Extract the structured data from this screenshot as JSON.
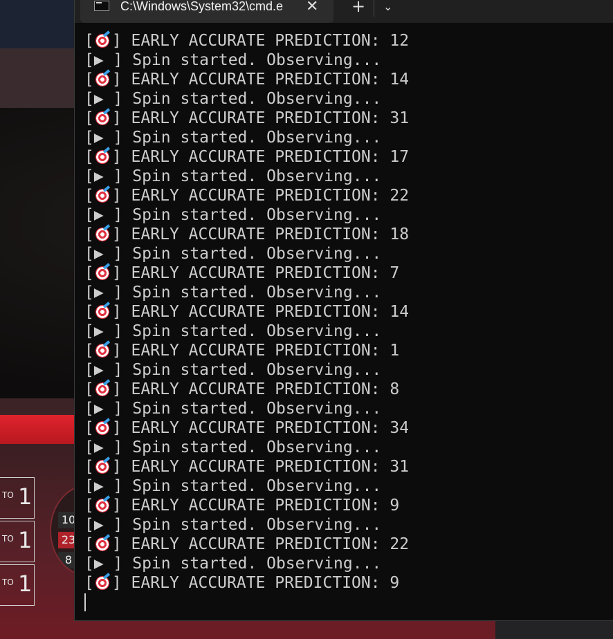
{
  "window": {
    "tab_title": "C:\\Windows\\System32\\cmd.e",
    "close_glyph": "✕",
    "new_tab_glyph": "+",
    "dropdown_glyph": "⌄"
  },
  "console": {
    "lines": [
      {
        "kind": "prediction",
        "text": "] EARLY ACCURATE PREDICTION: 12"
      },
      {
        "kind": "spin",
        "text": "[▶ ] Spin started. Observing..."
      },
      {
        "kind": "prediction",
        "text": "] EARLY ACCURATE PREDICTION: 14"
      },
      {
        "kind": "spin",
        "text": "[▶ ] Spin started. Observing..."
      },
      {
        "kind": "prediction",
        "text": "] EARLY ACCURATE PREDICTION: 31"
      },
      {
        "kind": "spin",
        "text": "[▶ ] Spin started. Observing..."
      },
      {
        "kind": "prediction",
        "text": "] EARLY ACCURATE PREDICTION: 17"
      },
      {
        "kind": "spin",
        "text": "[▶ ] Spin started. Observing..."
      },
      {
        "kind": "prediction",
        "text": "] EARLY ACCURATE PREDICTION: 22"
      },
      {
        "kind": "spin",
        "text": "[▶ ] Spin started. Observing..."
      },
      {
        "kind": "prediction",
        "text": "] EARLY ACCURATE PREDICTION: 18"
      },
      {
        "kind": "spin",
        "text": "[▶ ] Spin started. Observing..."
      },
      {
        "kind": "prediction",
        "text": "] EARLY ACCURATE PREDICTION: 7"
      },
      {
        "kind": "spin",
        "text": "[▶ ] Spin started. Observing..."
      },
      {
        "kind": "prediction",
        "text": "] EARLY ACCURATE PREDICTION: 14"
      },
      {
        "kind": "spin",
        "text": "[▶ ] Spin started. Observing..."
      },
      {
        "kind": "prediction",
        "text": "] EARLY ACCURATE PREDICTION: 1"
      },
      {
        "kind": "spin",
        "text": "[▶ ] Spin started. Observing..."
      },
      {
        "kind": "prediction",
        "text": "] EARLY ACCURATE PREDICTION: 8"
      },
      {
        "kind": "spin",
        "text": "[▶ ] Spin started. Observing..."
      },
      {
        "kind": "prediction",
        "text": "] EARLY ACCURATE PREDICTION: 34"
      },
      {
        "kind": "spin",
        "text": "[▶ ] Spin started. Observing..."
      },
      {
        "kind": "prediction",
        "text": "] EARLY ACCURATE PREDICTION: 31"
      },
      {
        "kind": "spin",
        "text": "[▶ ] Spin started. Observing..."
      },
      {
        "kind": "prediction",
        "text": "] EARLY ACCURATE PREDICTION: 9"
      },
      {
        "kind": "spin",
        "text": "[▶ ] Spin started. Observing..."
      },
      {
        "kind": "prediction",
        "text": "] EARLY ACCURATE PREDICTION: 22"
      },
      {
        "kind": "spin",
        "text": "[▶ ] Spin started. Observing..."
      },
      {
        "kind": "prediction",
        "text": "] EARLY ACCURATE PREDICTION: 9"
      }
    ]
  },
  "background_app": {
    "payouts": [
      {
        "to": "TO",
        "value": "1"
      },
      {
        "to": "TO",
        "value": "1"
      },
      {
        "to": "TO",
        "value": "1"
      }
    ],
    "wheel_numbers": [
      {
        "label": "10",
        "color": "black"
      },
      {
        "label": "23",
        "color": "red"
      },
      {
        "label": "8",
        "color": "black"
      }
    ],
    "colors": {
      "accent_red": "#e0232c",
      "terminal_bg": "#0c0c0c",
      "terminal_text": "#cccccc"
    }
  }
}
